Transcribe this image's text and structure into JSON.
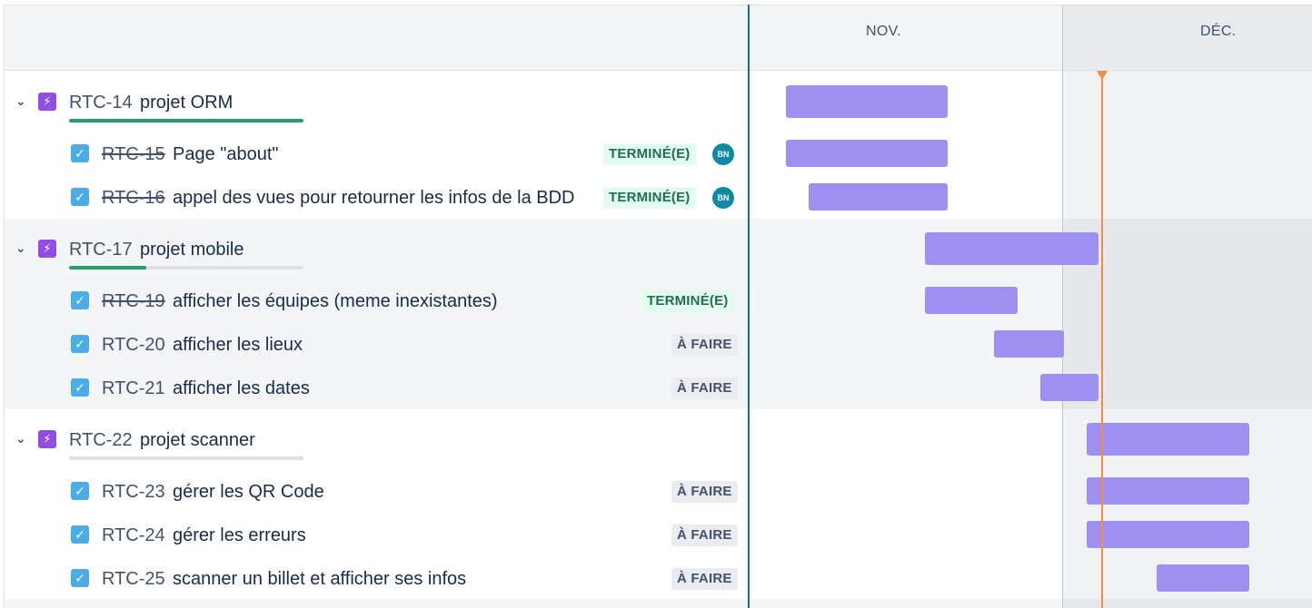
{
  "header": {
    "months": [
      "NOV.",
      "DÉC."
    ]
  },
  "colors": {
    "epic": "#904ee2",
    "task": "#4bade8",
    "bar": "#9f8fef",
    "today": "#f18d45",
    "done_progress": "#22a06b"
  },
  "epics": [
    {
      "key": "RTC-14",
      "summary": "projet ORM",
      "progress": 1.0,
      "children": [
        {
          "key": "RTC-15",
          "summary": "Page \"about\"",
          "status": "TERMINÉ(E)",
          "done": true,
          "assignee": "BN"
        },
        {
          "key": "RTC-16",
          "summary": "appel des vues pour retourner les infos de la BDD",
          "status": "TERMINÉ(E)",
          "done": true,
          "assignee": "BN"
        }
      ]
    },
    {
      "key": "RTC-17",
      "summary": "projet mobile",
      "progress": 0.33,
      "children": [
        {
          "key": "RTC-19",
          "summary": "afficher les équipes (meme inexistantes)",
          "status": "TERMINÉ(E)",
          "done": true
        },
        {
          "key": "RTC-20",
          "summary": "afficher les lieux",
          "status": "À FAIRE",
          "done": false
        },
        {
          "key": "RTC-21",
          "summary": "afficher les dates",
          "status": "À FAIRE",
          "done": false
        }
      ]
    },
    {
      "key": "RTC-22",
      "summary": "projet scanner",
      "progress": 0.0,
      "children": [
        {
          "key": "RTC-23",
          "summary": "gérer les QR Code",
          "status": "À FAIRE",
          "done": false
        },
        {
          "key": "RTC-24",
          "summary": "gérer les erreurs",
          "status": "À FAIRE",
          "done": false
        },
        {
          "key": "RTC-25",
          "summary": "scanner un billet et afficher ses infos",
          "status": "À FAIRE",
          "done": false
        }
      ]
    }
  ]
}
